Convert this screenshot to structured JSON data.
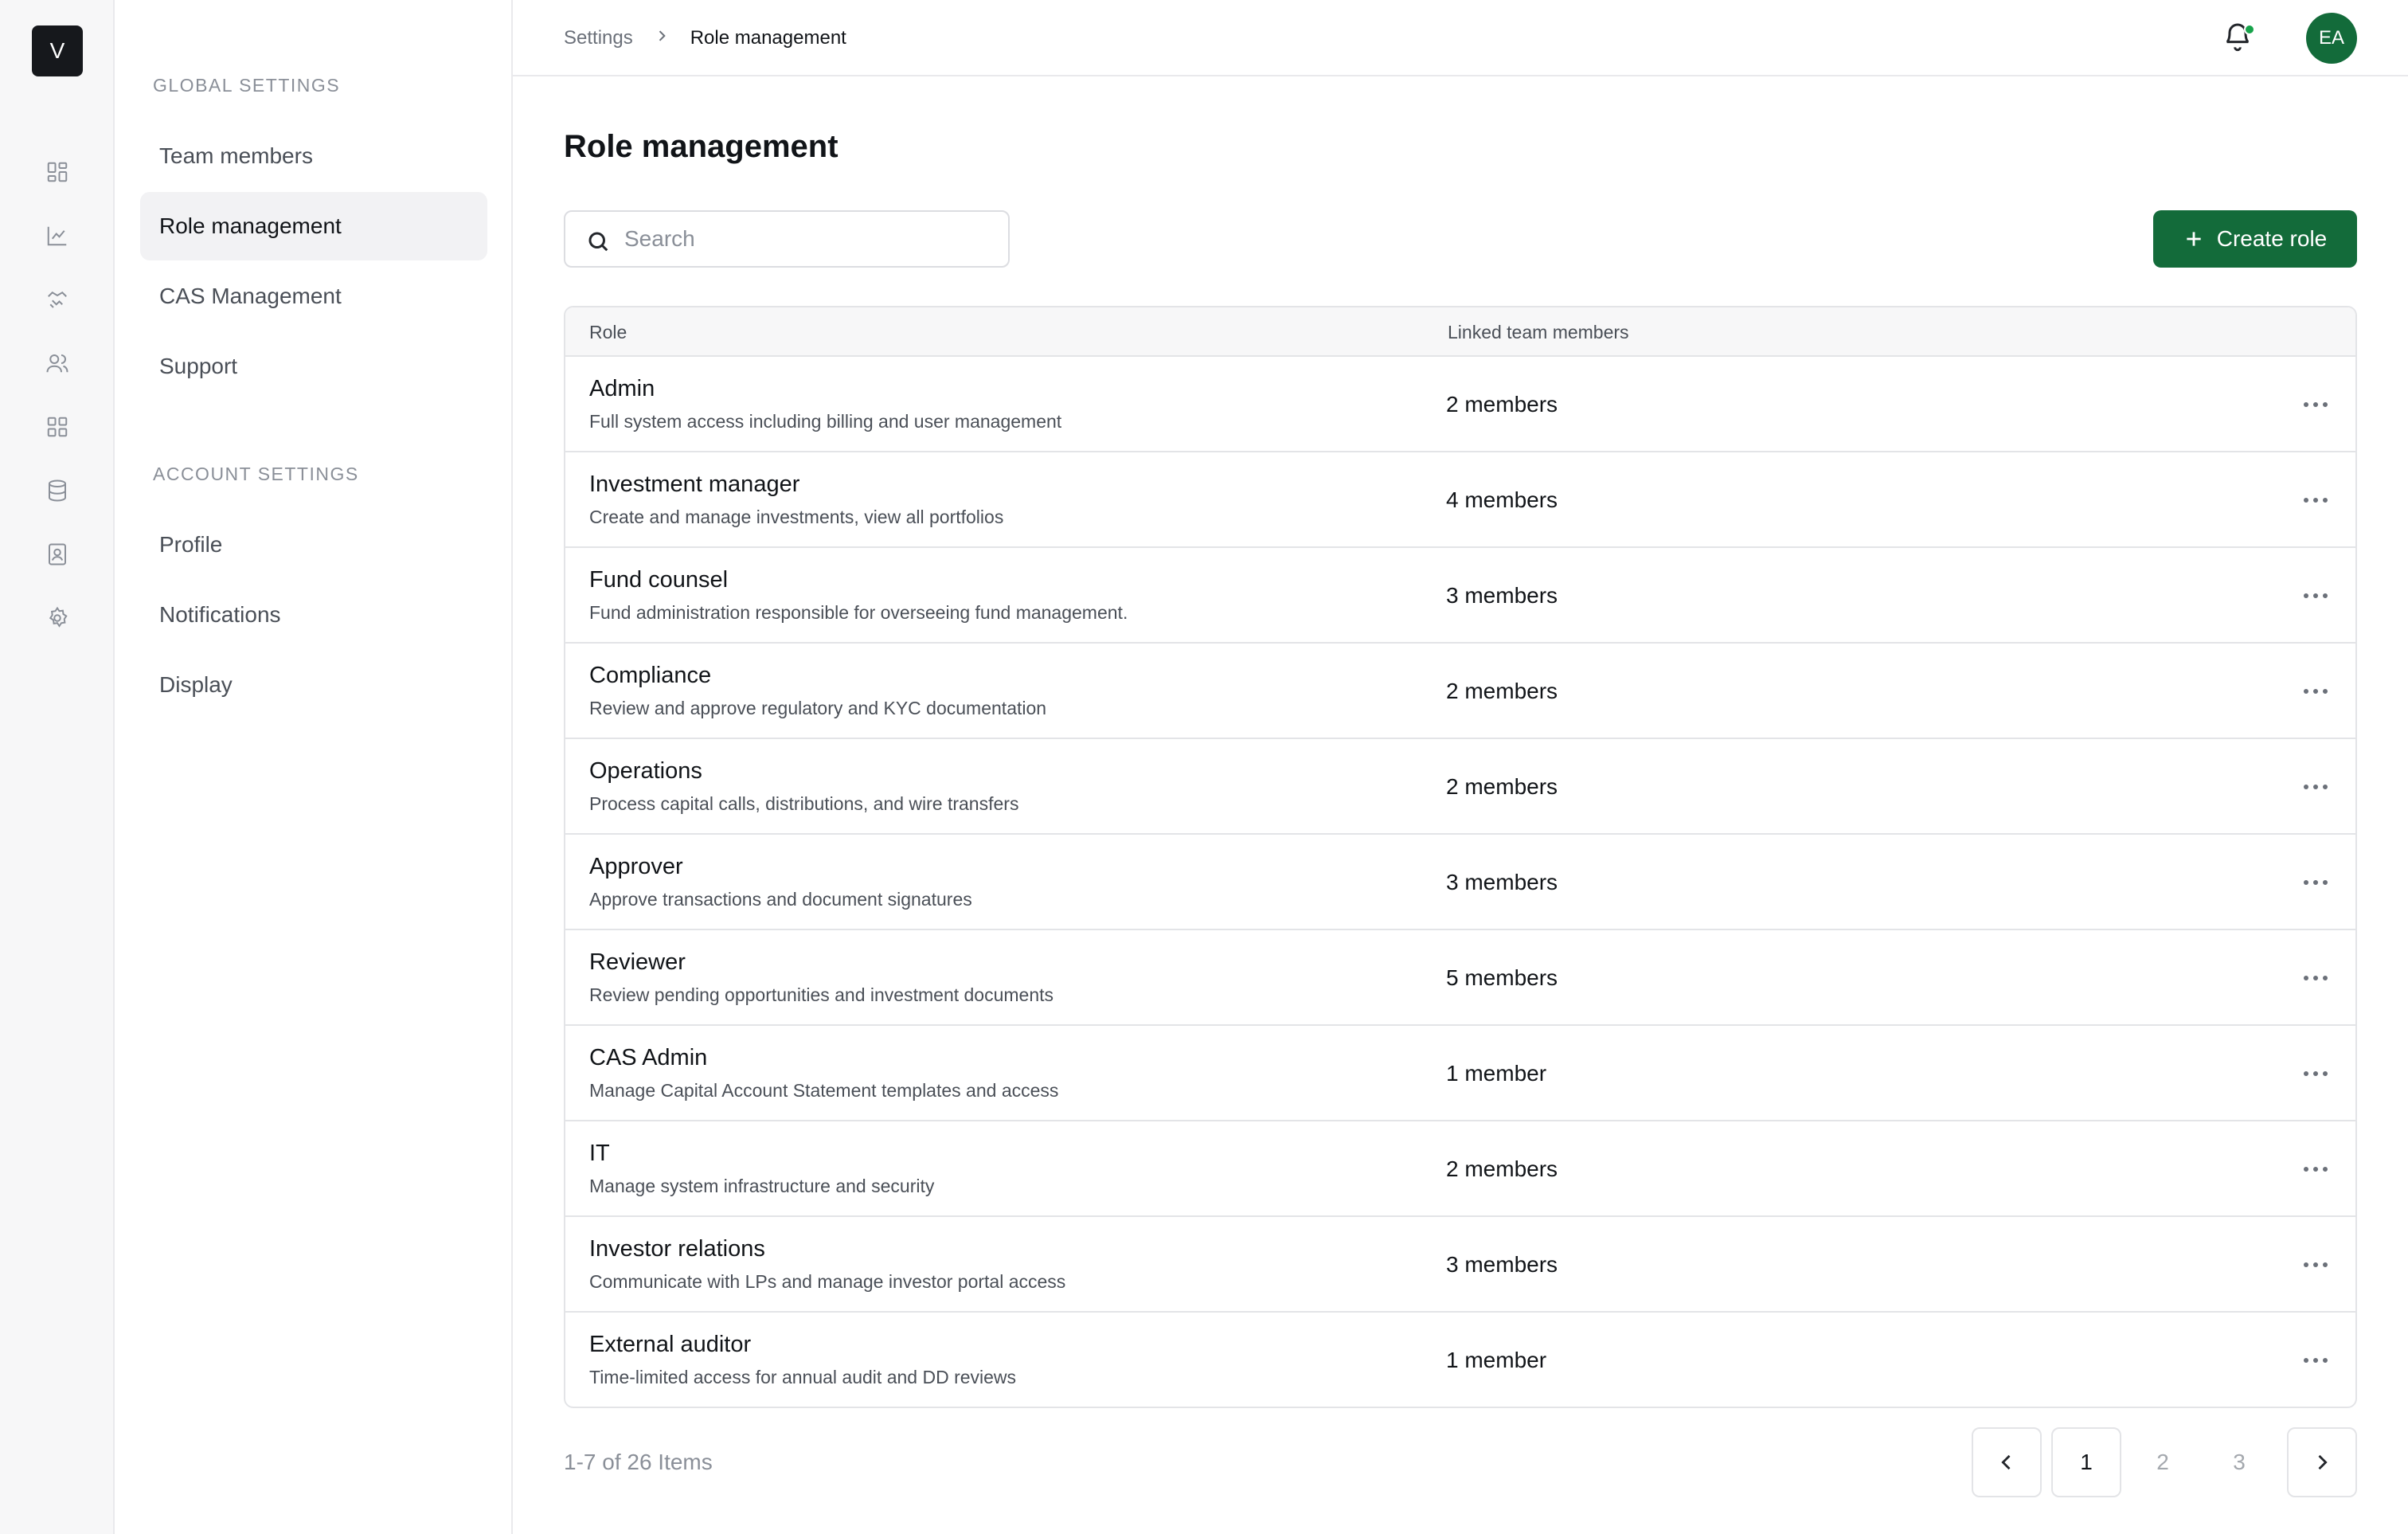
{
  "logo": {
    "letter": "V"
  },
  "rail": {
    "icons": [
      "dashboard-icon",
      "chart-icon",
      "handshake-icon",
      "users-icon",
      "grid-icon",
      "database-icon",
      "contacts-icon",
      "gear-icon"
    ]
  },
  "settings_nav": {
    "global_heading": "GLOBAL SETTINGS",
    "global_items": [
      {
        "label": "Team members"
      },
      {
        "label": "Role management",
        "active": true
      },
      {
        "label": "CAS Management"
      },
      {
        "label": "Support"
      }
    ],
    "account_heading": "ACCOUNT SETTINGS",
    "account_items": [
      {
        "label": "Profile"
      },
      {
        "label": "Notifications"
      },
      {
        "label": "Display"
      }
    ]
  },
  "topbar": {
    "breadcrumb": {
      "parent": "Settings",
      "current": "Role management"
    },
    "avatar_initials": "EA",
    "notification_dot_color": "#17a34a"
  },
  "main": {
    "title": "Role management",
    "search_placeholder": "Search",
    "create_button_label": "Create role",
    "accent_color": "#136b3a"
  },
  "table": {
    "columns": {
      "role": "Role",
      "members": "Linked team members"
    },
    "rows": [
      {
        "name": "Admin",
        "description": "Full system access including billing and user management",
        "members": "2 members"
      },
      {
        "name": "Investment manager",
        "description": "Create and manage investments, view all portfolios",
        "members": "4 members"
      },
      {
        "name": "Fund counsel",
        "description": "Fund administration responsible for overseeing fund management.",
        "members": "3 members"
      },
      {
        "name": "Compliance",
        "description": "Review and approve regulatory and KYC documentation",
        "members": "2 members"
      },
      {
        "name": "Operations",
        "description": "Process capital calls, distributions, and wire transfers",
        "members": "2 members"
      },
      {
        "name": "Approver",
        "description": "Approve transactions and document signatures",
        "members": "3 members"
      },
      {
        "name": "Reviewer",
        "description": "Review pending opportunities and investment documents",
        "members": "5 members"
      },
      {
        "name": "CAS Admin",
        "description": "Manage Capital Account Statement templates and access",
        "members": "1 member"
      },
      {
        "name": "IT",
        "description": "Manage system infrastructure and security",
        "members": "2 members"
      },
      {
        "name": "Investor relations",
        "description": "Communicate with LPs and manage investor portal access",
        "members": "3 members"
      },
      {
        "name": "External auditor",
        "description": "Time-limited access for annual audit and DD reviews",
        "members": "1 member"
      }
    ]
  },
  "pagination": {
    "summary": "1-7 of 26 Items",
    "pages": [
      "1",
      "2",
      "3"
    ],
    "current_page": "1"
  }
}
